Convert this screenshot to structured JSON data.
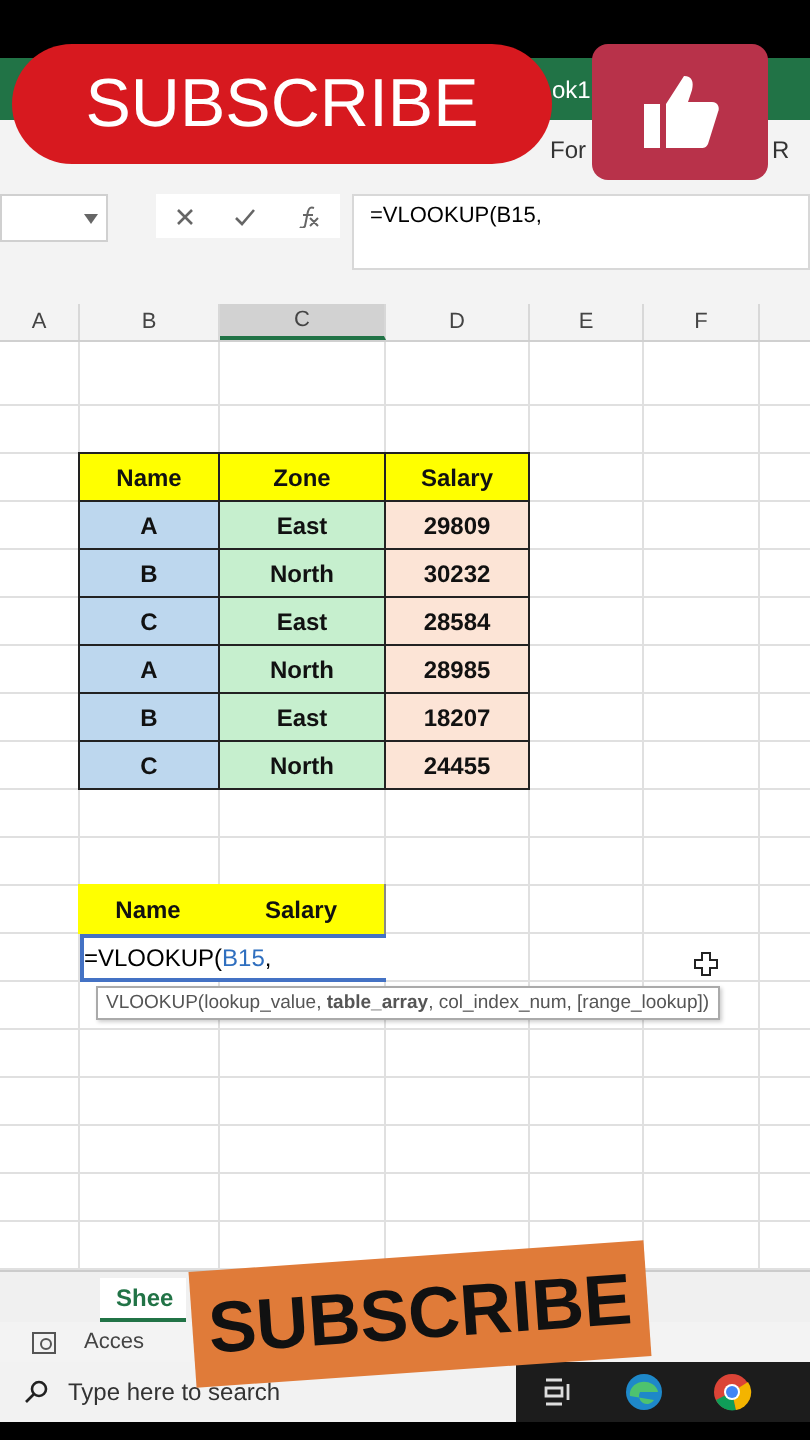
{
  "title_bar": {
    "fragments": [
      "ok1"
    ]
  },
  "ribbon": {
    "fragments": [
      "For",
      "R"
    ]
  },
  "formula_bar": {
    "formula": "=VLOOKUP(B15,"
  },
  "column_headers": [
    {
      "label": "A",
      "selected": false
    },
    {
      "label": "B",
      "selected": false
    },
    {
      "label": "C",
      "selected": true
    },
    {
      "label": "D",
      "selected": false
    },
    {
      "label": "E",
      "selected": false
    },
    {
      "label": "F",
      "selected": false
    }
  ],
  "table": {
    "columns": [
      {
        "label": "Name",
        "color": "#bdd7ee"
      },
      {
        "label": "Zone",
        "color": "#c6efce"
      },
      {
        "label": "Salary",
        "color": "#fce4d6"
      }
    ],
    "rows": [
      [
        "A",
        "East",
        "29809"
      ],
      [
        "B",
        "North",
        "30232"
      ],
      [
        "C",
        "East",
        "28584"
      ],
      [
        "A",
        "North",
        "28985"
      ],
      [
        "B",
        "East",
        "18207"
      ],
      [
        "C",
        "North",
        "24455"
      ]
    ]
  },
  "lookup_table": {
    "columns": [
      "Name",
      "Salary"
    ],
    "active_cell": {
      "prefix": "=VLOOKUP(",
      "reference": "B15",
      "suffix": ","
    }
  },
  "tooltip": "VLOOKUP(lookup_value, **table_array**, col_index_num, [range_lookup])",
  "sheet_tabs": [
    {
      "label": "Shee",
      "selected": true
    }
  ],
  "status_bar": {
    "text": "Acces"
  },
  "taskbar": {
    "search_placeholder": "Type here to search"
  },
  "overlays": [
    {
      "kind": "pill",
      "text": "SUBSCRIBE"
    },
    {
      "kind": "like"
    },
    {
      "kind": "tilted",
      "text": "SUBSCRIBE"
    }
  ]
}
